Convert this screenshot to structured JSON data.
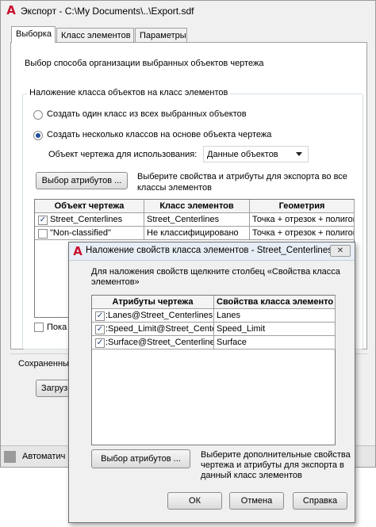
{
  "main_window": {
    "title": "Экспорт - C:\\My Documents\\..\\Export.sdf",
    "tabs": [
      {
        "label": "Выборка"
      },
      {
        "label": "Класс элементов"
      },
      {
        "label": "Параметры"
      }
    ],
    "intro": "Выбор способа организации выбранных объектов чертежа",
    "group_title": "Наложение класса объектов на класс элементов",
    "radio_single": "Создать один класс из всех выбранных объектов",
    "radio_multi": "Создать несколько классов на основе объекта чертежа",
    "object_label": "Объект чертежа для использования:",
    "object_value": "Данные объектов",
    "select_attrs_button": "Выбор атрибутов ...",
    "select_attrs_hint": "Выберите свойства и атрибуты для экспорта во все классы элементов",
    "table": {
      "headers": [
        "Объект чертежа",
        "Класс элементов",
        "Геометрия"
      ],
      "rows": [
        {
          "checked": true,
          "object": "Street_Centerlines",
          "class": "Street_Centerlines",
          "geometry": "Точка + отрезок + полигон"
        },
        {
          "checked": false,
          "object": "\"Non-classified\"",
          "class": "Не классифицировано",
          "geometry": "Точка + отрезок + полигон"
        }
      ]
    },
    "show_checkbox_label": "Пока",
    "saved_label": "Сохраненны",
    "load_button": "Загруз",
    "status_text": "Автоматич"
  },
  "dialog": {
    "title": "Наложение свойств класса элементов - Street_Centerlines",
    "close_glyph": "✕",
    "instruction": "Для наложения свойств щелкните столбец «Свойства класса элементов»",
    "table": {
      "headers": [
        "Атрибуты чертежа",
        "Свойства класса элементо"
      ],
      "rows": [
        {
          "checked": true,
          "attribute": ":Lanes@Street_Centerlines",
          "property": "Lanes"
        },
        {
          "checked": true,
          "attribute": ":Speed_Limit@Street_Center",
          "property": "Speed_Limit"
        },
        {
          "checked": true,
          "attribute": ":Surface@Street_Centerline",
          "property": "Surface"
        }
      ]
    },
    "select_attrs_button": "Выбор атрибутов ...",
    "select_attrs_hint": "Выберите дополнительные свойства чертежа и атрибуты для экспорта в данный класс элементов",
    "ok_button": "ОК",
    "cancel_button": "Отмена",
    "help_button": "Справка"
  },
  "colors": {
    "accent": "#1e4f9a",
    "logo": "#c8102e"
  }
}
